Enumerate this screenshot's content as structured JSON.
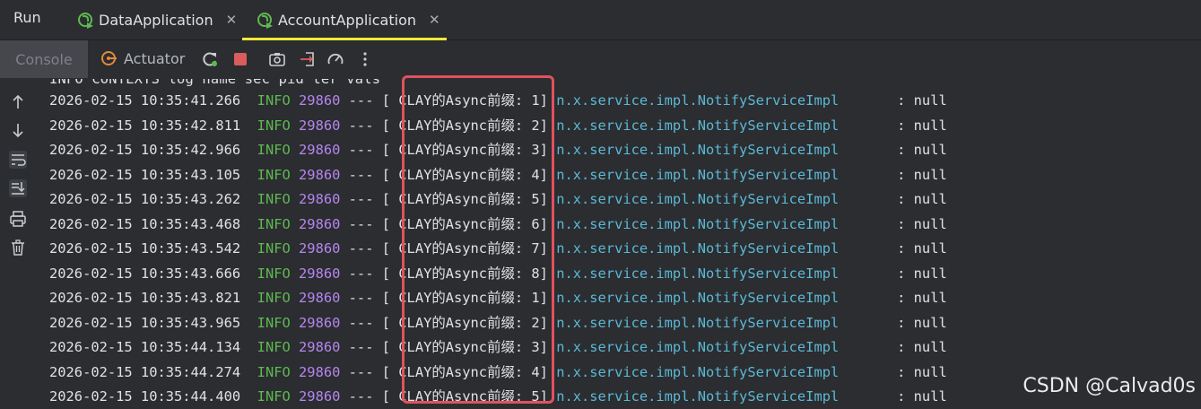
{
  "topbar": {
    "run_label": "Run",
    "tabs": [
      {
        "label": "DataApplication",
        "icon": "spring-run-icon",
        "active": false
      },
      {
        "label": "AccountApplication",
        "icon": "spring-run-icon",
        "active": true
      }
    ]
  },
  "toolbar": {
    "console_label": "Console",
    "actuator_label": "Actuator",
    "icons": [
      "rerun-icon",
      "stop-icon",
      "screenshot-icon",
      "exit-icon",
      "dashboard-icon",
      "more-icon"
    ]
  },
  "gutter_icons": [
    "up-arrow-icon",
    "down-arrow-icon",
    "soft-wrap-icon",
    "scroll-to-end-icon",
    "print-icon",
    "trash-icon"
  ],
  "console": {
    "partial_line": "INFO CONTEXTS log name sec pid ter vals",
    "lines": [
      {
        "ts": "2026-02-15 10:35:41.266",
        "level": "INFO",
        "pid": "29860",
        "sep": "---",
        "thread": "[ CLAY的Async前缀: 1]",
        "cls": "n.x.service.impl.NotifyServiceImpl",
        "msg": ": null"
      },
      {
        "ts": "2026-02-15 10:35:42.811",
        "level": "INFO",
        "pid": "29860",
        "sep": "---",
        "thread": "[ CLAY的Async前缀: 2]",
        "cls": "n.x.service.impl.NotifyServiceImpl",
        "msg": ": null"
      },
      {
        "ts": "2026-02-15 10:35:42.966",
        "level": "INFO",
        "pid": "29860",
        "sep": "---",
        "thread": "[ CLAY的Async前缀: 3]",
        "cls": "n.x.service.impl.NotifyServiceImpl",
        "msg": ": null"
      },
      {
        "ts": "2026-02-15 10:35:43.105",
        "level": "INFO",
        "pid": "29860",
        "sep": "---",
        "thread": "[ CLAY的Async前缀: 4]",
        "cls": "n.x.service.impl.NotifyServiceImpl",
        "msg": ": null"
      },
      {
        "ts": "2026-02-15 10:35:43.262",
        "level": "INFO",
        "pid": "29860",
        "sep": "---",
        "thread": "[ CLAY的Async前缀: 5]",
        "cls": "n.x.service.impl.NotifyServiceImpl",
        "msg": ": null"
      },
      {
        "ts": "2026-02-15 10:35:43.468",
        "level": "INFO",
        "pid": "29860",
        "sep": "---",
        "thread": "[ CLAY的Async前缀: 6]",
        "cls": "n.x.service.impl.NotifyServiceImpl",
        "msg": ": null"
      },
      {
        "ts": "2026-02-15 10:35:43.542",
        "level": "INFO",
        "pid": "29860",
        "sep": "---",
        "thread": "[ CLAY的Async前缀: 7]",
        "cls": "n.x.service.impl.NotifyServiceImpl",
        "msg": ": null"
      },
      {
        "ts": "2026-02-15 10:35:43.666",
        "level": "INFO",
        "pid": "29860",
        "sep": "---",
        "thread": "[ CLAY的Async前缀: 8]",
        "cls": "n.x.service.impl.NotifyServiceImpl",
        "msg": ": null"
      },
      {
        "ts": "2026-02-15 10:35:43.821",
        "level": "INFO",
        "pid": "29860",
        "sep": "---",
        "thread": "[ CLAY的Async前缀: 1]",
        "cls": "n.x.service.impl.NotifyServiceImpl",
        "msg": ": null"
      },
      {
        "ts": "2026-02-15 10:35:43.965",
        "level": "INFO",
        "pid": "29860",
        "sep": "---",
        "thread": "[ CLAY的Async前缀: 2]",
        "cls": "n.x.service.impl.NotifyServiceImpl",
        "msg": ": null"
      },
      {
        "ts": "2026-02-15 10:35:44.134",
        "level": "INFO",
        "pid": "29860",
        "sep": "---",
        "thread": "[ CLAY的Async前缀: 3]",
        "cls": "n.x.service.impl.NotifyServiceImpl",
        "msg": ": null"
      },
      {
        "ts": "2026-02-15 10:35:44.274",
        "level": "INFO",
        "pid": "29860",
        "sep": "---",
        "thread": "[ CLAY的Async前缀: 4]",
        "cls": "n.x.service.impl.NotifyServiceImpl",
        "msg": ": null"
      },
      {
        "ts": "2026-02-15 10:35:44.400",
        "level": "INFO",
        "pid": "29860",
        "sep": "---",
        "thread": "[ CLAY的Async前缀: 5]",
        "cls": "n.x.service.impl.NotifyServiceImpl",
        "msg": ": null"
      }
    ]
  },
  "colors": {
    "background": "#2b2d30",
    "info": "#5fb852",
    "pid": "#b785f0",
    "class": "#5cb8d6",
    "highlight": "#e0525e",
    "active_tab_underline": "#f0ea36"
  },
  "watermark": "CSDN @Calvad0s"
}
